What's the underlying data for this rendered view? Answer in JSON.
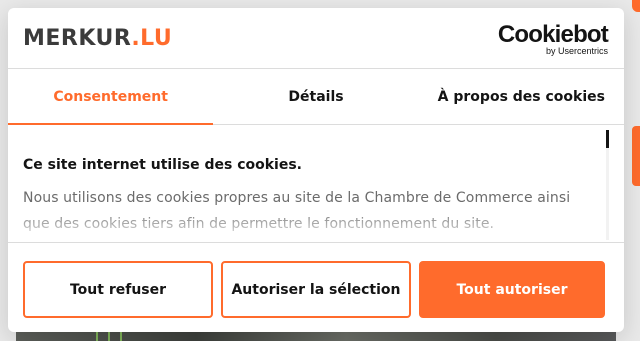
{
  "brand": {
    "logo_part1": "MERKUR",
    "logo_part2": ".LU"
  },
  "provider": {
    "name": "Cookiebot",
    "by": "by Usercentrics"
  },
  "tabs": [
    {
      "label": "Consentement",
      "active": true
    },
    {
      "label": "Détails",
      "active": false
    },
    {
      "label": "À propos des cookies",
      "active": false
    }
  ],
  "content": {
    "heading": "Ce site internet utilise des cookies.",
    "paragraph": "Nous utilisons des cookies propres au site de la Chambre de Commerce ainsi que des cookies tiers afin de permettre le fonctionnement du site."
  },
  "buttons": {
    "reject": "Tout refuser",
    "allow_selection": "Autoriser la sélection",
    "allow_all": "Tout autoriser"
  },
  "colors": {
    "accent": "#ff6b2c",
    "text": "#141414",
    "muted": "#6b6b6b"
  }
}
